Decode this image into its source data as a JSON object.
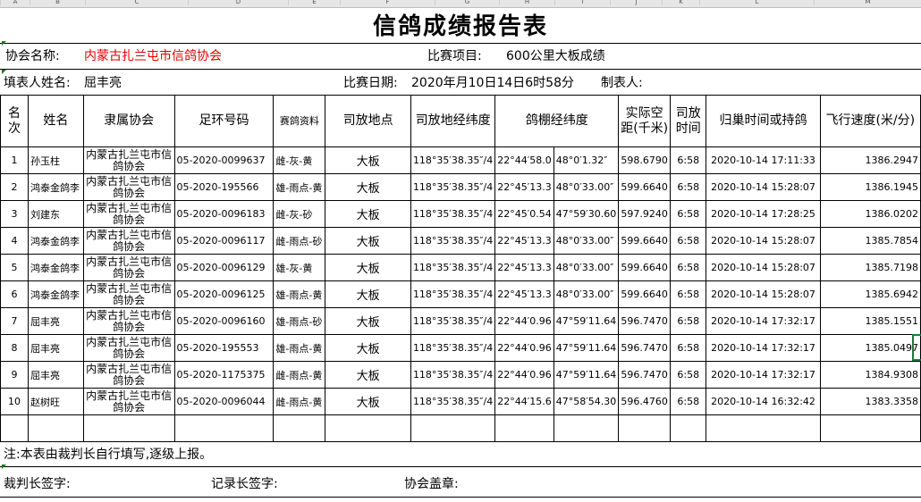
{
  "column_letters": [
    "A",
    "B",
    "C",
    "D",
    "E",
    "F",
    "G",
    "H",
    "I",
    "J",
    "K",
    "L",
    "M"
  ],
  "report": {
    "title": "信鸽成绩报告表",
    "association_label": "协会名称:",
    "association_name": "内蒙古扎兰屯市信鸽协会",
    "race_item_label": "比赛项目:",
    "race_item": "600公里大板成绩",
    "filler_label": "填表人姓名:",
    "filler_name": "屈丰亮",
    "race_date_label": "比赛日期:",
    "race_date": "2020年月10日14日6时58分",
    "maker_label": "制表人:"
  },
  "table": {
    "headers": [
      "名次",
      "姓名",
      "隶属协会",
      "足环号码",
      "赛鸽资料",
      "司放地点",
      "司放地经纬度",
      "鸽棚经纬度",
      "实际空距(千米)",
      "司放时间",
      "归巢时间或持鸽",
      "飞行速度(米/分)"
    ],
    "rows": [
      {
        "rank": "1",
        "name": "孙玉柱",
        "assoc": "内蒙古扎兰屯市信鸽协会",
        "ring": "05-2020-0099637",
        "info": "雌-灰-黄",
        "site": "大板",
        "site_ll": "118°35′38.35″/4",
        "loft_lat": "22°44′58.0",
        "loft_lng": "48°0′1.32″",
        "dist": "598.6790",
        "release": "6:58",
        "arrival": "2020-10-14 17:11:33",
        "speed": "1386.2947"
      },
      {
        "rank": "2",
        "name": "鸿泰金鸽李",
        "assoc": "内蒙古扎兰屯市信鸽协会",
        "ring": "05-2020-195566",
        "info": "雄-雨点-黄",
        "site": "大板",
        "site_ll": "118°35′38.35″/4",
        "loft_lat": "22°45′13.3",
        "loft_lng": "48°0′33.00″",
        "dist": "599.6640",
        "release": "6:58",
        "arrival": "2020-10-14 15:28:07",
        "speed": "1386.1945"
      },
      {
        "rank": "3",
        "name": "刘建东",
        "assoc": "内蒙古扎兰屯市信鸽协会",
        "ring": "05-2020-0096183",
        "info": "雌-灰-砂",
        "site": "大板",
        "site_ll": "118°35′38.35″/4",
        "loft_lat": "22°45′0.54",
        "loft_lng": "47°59′30.60",
        "dist": "597.9240",
        "release": "6:58",
        "arrival": "2020-10-14 17:28:25",
        "speed": "1386.0202"
      },
      {
        "rank": "4",
        "name": "鸿泰金鸽李",
        "assoc": "内蒙古扎兰屯市信鸽协会",
        "ring": "05-2020-0096117",
        "info": "雌-雨点-砂",
        "site": "大板",
        "site_ll": "118°35′38.35″/4",
        "loft_lat": "22°45′13.3",
        "loft_lng": "48°0′33.00″",
        "dist": "599.6640",
        "release": "6:58",
        "arrival": "2020-10-14 15:28:07",
        "speed": "1385.7854"
      },
      {
        "rank": "5",
        "name": "鸿泰金鸽李",
        "assoc": "内蒙古扎兰屯市信鸽协会",
        "ring": "05-2020-0096129",
        "info": "雄-灰-黄",
        "site": "大板",
        "site_ll": "118°35′38.35″/4",
        "loft_lat": "22°45′13.3",
        "loft_lng": "48°0′33.00″",
        "dist": "599.6640",
        "release": "6:58",
        "arrival": "2020-10-14 15:28:07",
        "speed": "1385.7198"
      },
      {
        "rank": "6",
        "name": "鸿泰金鸽李",
        "assoc": "内蒙古扎兰屯市信鸽协会",
        "ring": "05-2020-0096125",
        "info": "雄-雨点-黄",
        "site": "大板",
        "site_ll": "118°35′38.35″/4",
        "loft_lat": "22°45′13.3",
        "loft_lng": "48°0′33.00″",
        "dist": "599.6640",
        "release": "6:58",
        "arrival": "2020-10-14 15:28:07",
        "speed": "1385.6942"
      },
      {
        "rank": "7",
        "name": "屈丰亮",
        "assoc": "内蒙古扎兰屯市信鸽协会",
        "ring": "05-2020-0096160",
        "info": "雄-雨点-砂",
        "site": "大板",
        "site_ll": "118°35′38.35″/4",
        "loft_lat": "22°44′0.96",
        "loft_lng": "47°59′11.64",
        "dist": "596.7470",
        "release": "6:58",
        "arrival": "2020-10-14 17:32:17",
        "speed": "1385.1551"
      },
      {
        "rank": "8",
        "name": "屈丰亮",
        "assoc": "内蒙古扎兰屯市信鸽协会",
        "ring": "05-2020-195553",
        "info": "雄-雨点-黄",
        "site": "大板",
        "site_ll": "118°35′38.35″/4",
        "loft_lat": "22°44′0.96",
        "loft_lng": "47°59′11.64",
        "dist": "596.7470",
        "release": "6:58",
        "arrival": "2020-10-14 17:32:17",
        "speed": "1385.0497"
      },
      {
        "rank": "9",
        "name": "屈丰亮",
        "assoc": "内蒙古扎兰屯市信鸽协会",
        "ring": "05-2020-1175375",
        "info": "雌-雨点-黄",
        "site": "大板",
        "site_ll": "118°35′38.35″/4",
        "loft_lat": "22°44′0.96",
        "loft_lng": "47°59′11.64",
        "dist": "596.7470",
        "release": "6:58",
        "arrival": "2020-10-14 17:32:17",
        "speed": "1384.9308"
      },
      {
        "rank": "10",
        "name": "赵树旺",
        "assoc": "内蒙古扎兰屯市信鸽协会",
        "ring": "05-2020-0096044",
        "info": "雌-雨点-黄",
        "site": "大板",
        "site_ll": "118°35′38.35″/4",
        "loft_lat": "22°44′15.6",
        "loft_lng": "47°58′54.30",
        "dist": "596.4760",
        "release": "6:58",
        "arrival": "2020-10-14 16:32:42",
        "speed": "1383.3358"
      }
    ]
  },
  "footer": {
    "note": "注:本表由裁判长自行填写,逐级上报。",
    "judge_sign": "裁判长签字:",
    "recorder_sign": "记录长签字:",
    "assoc_seal": "协会盖章:"
  },
  "colors": {
    "association_name": "#e00000",
    "selection": "#1b7a3a"
  }
}
